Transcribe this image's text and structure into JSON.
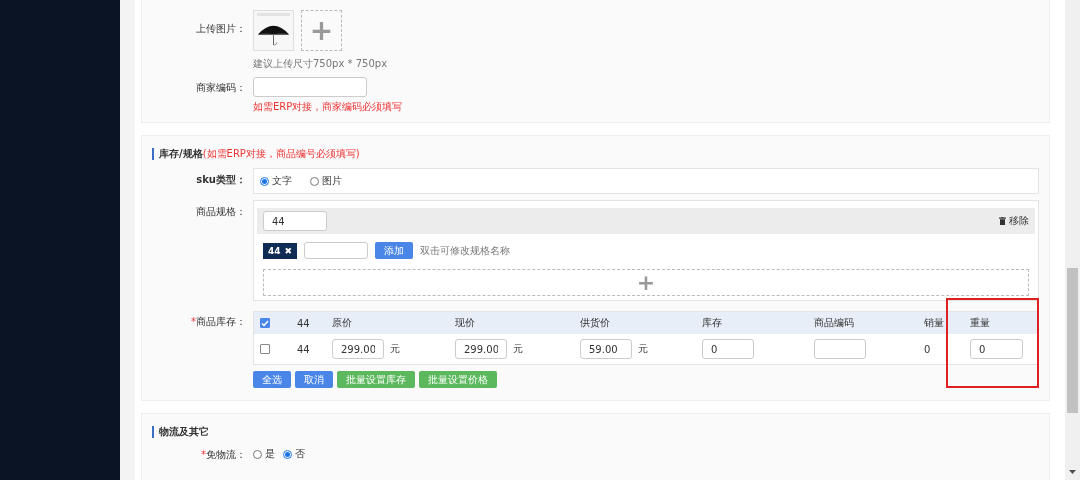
{
  "upload": {
    "label": "上传图片：",
    "add_icon": "+",
    "hint": "建议上传尺寸750px * 750px"
  },
  "merchant_code": {
    "label": "商家编码：",
    "hint": "如需ERP对接，商家编码必须填写"
  },
  "stock_section": {
    "title": "库存/规格",
    "title_note": "(如需ERP对接，商品编号必须填写)",
    "sku_type": {
      "label": "sku类型：",
      "options": [
        {
          "label": "文字",
          "selected": true
        },
        {
          "label": "图片",
          "selected": false
        }
      ]
    },
    "spec": {
      "label": "商品规格：",
      "name_value": "44",
      "remove": "移除",
      "tags": [
        {
          "label": "44",
          "close": "✖"
        }
      ],
      "add_button": "添加",
      "hint": "双击可修改规格名称",
      "add_icon": "+"
    },
    "stock": {
      "label": "商品库存：",
      "required_mark": "*",
      "header": {
        "checked": true,
        "cells": [
          "44",
          "原价",
          "现价",
          "供货价",
          "库存",
          "商品编码",
          "销量",
          "重量"
        ]
      },
      "rows": [
        {
          "checked": false,
          "cells": [
            {
              "kind": "text",
              "text": "44"
            },
            {
              "kind": "input",
              "value": "299.00",
              "unit": "元"
            },
            {
              "kind": "input",
              "value": "299.00",
              "unit": "元"
            },
            {
              "kind": "input",
              "value": "59.00",
              "unit": "元"
            },
            {
              "kind": "input",
              "value": "0"
            },
            {
              "kind": "input"
            },
            {
              "kind": "text",
              "text": "0"
            },
            {
              "kind": "input",
              "value": "0"
            }
          ]
        }
      ]
    },
    "buttons": [
      {
        "label": "全选",
        "kind": "primary"
      },
      {
        "label": "取消",
        "kind": "primary"
      },
      {
        "label": "批量设置库存",
        "kind": "success"
      },
      {
        "label": "批量设置价格",
        "kind": "success"
      }
    ]
  },
  "logistics_section": {
    "title": "物流及其它",
    "free_shipping": {
      "label": "免物流：",
      "required_mark": "*",
      "options": [
        {
          "label": "是",
          "selected": false
        },
        {
          "label": "否",
          "selected": true
        }
      ]
    }
  }
}
